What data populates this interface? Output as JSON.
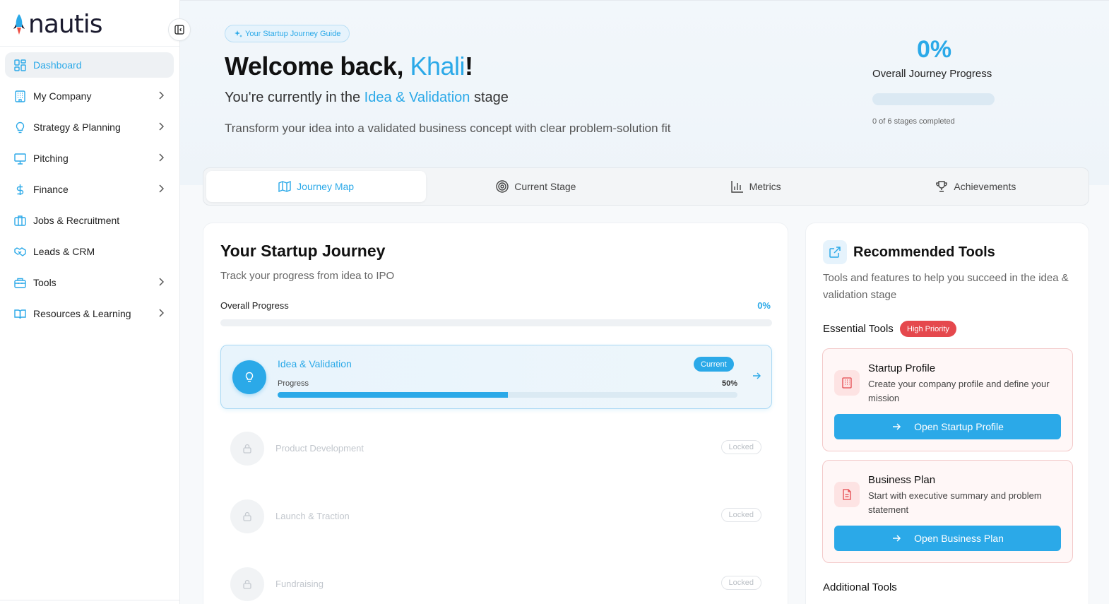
{
  "app": {
    "brand": "nautis"
  },
  "sidebar": {
    "items": [
      {
        "label": "Dashboard",
        "icon": "dashboard-icon",
        "active": true,
        "chevron": false
      },
      {
        "label": "My Company",
        "icon": "building-icon",
        "active": false,
        "chevron": true
      },
      {
        "label": "Strategy & Planning",
        "icon": "lightbulb-icon",
        "active": false,
        "chevron": true
      },
      {
        "label": "Pitching",
        "icon": "presentation-icon",
        "active": false,
        "chevron": true
      },
      {
        "label": "Finance",
        "icon": "dollar-icon",
        "active": false,
        "chevron": true
      },
      {
        "label": "Jobs & Recruitment",
        "icon": "briefcase-icon",
        "active": false,
        "chevron": false
      },
      {
        "label": "Leads & CRM",
        "icon": "handshake-icon",
        "active": false,
        "chevron": false
      },
      {
        "label": "Tools",
        "icon": "toolbox-icon",
        "active": false,
        "chevron": true
      },
      {
        "label": "Resources & Learning",
        "icon": "book-icon",
        "active": false,
        "chevron": true
      }
    ]
  },
  "hero": {
    "guide_label": "Your Startup Journey Guide",
    "welcome_prefix": "Welcome back, ",
    "user_name": "Khali",
    "welcome_suffix": "!",
    "stage_prefix": "You're currently in the ",
    "stage_name": "Idea & Validation",
    "stage_suffix": " stage",
    "description": "Transform your idea into a validated business concept with clear problem-solution fit",
    "progress_percent": "0%",
    "progress_label": "Overall Journey Progress",
    "progress_fraction": 0,
    "stages_completed": "0 of 6 stages completed"
  },
  "tabs": [
    {
      "label": "Journey Map",
      "icon": "map-icon",
      "active": true
    },
    {
      "label": "Current Stage",
      "icon": "target-icon",
      "active": false
    },
    {
      "label": "Metrics",
      "icon": "bar-chart-icon",
      "active": false
    },
    {
      "label": "Achievements",
      "icon": "trophy-icon",
      "active": false
    }
  ],
  "journey": {
    "title": "Your Startup Journey",
    "subtitle": "Track your progress from idea to IPO",
    "overall_label": "Overall Progress",
    "overall_percent": "0%",
    "current_stage": {
      "name": "Idea & Validation",
      "badge": "Current",
      "progress_label": "Progress",
      "progress_percent": "50%",
      "progress_fraction": 0.5
    },
    "locked_stages": [
      {
        "name": "Product Development",
        "badge": "Locked"
      },
      {
        "name": "Launch & Traction",
        "badge": "Locked"
      },
      {
        "name": "Fundraising",
        "badge": "Locked"
      }
    ]
  },
  "tools": {
    "title": "Recommended Tools",
    "subtitle": "Tools and features to help you succeed in the idea & validation stage",
    "essential_label": "Essential Tools",
    "priority_badge": "High Priority",
    "cards": [
      {
        "name": "Startup Profile",
        "description": "Create your company profile and define your mission",
        "button": "Open Startup Profile",
        "icon": "building-icon"
      },
      {
        "name": "Business Plan",
        "description": "Start with executive summary and problem statement",
        "button": "Open Business Plan",
        "icon": "document-icon"
      }
    ],
    "additional_label": "Additional Tools"
  },
  "colors": {
    "accent": "#2ba9e8",
    "danger": "#e5484d",
    "text": "#111111"
  }
}
